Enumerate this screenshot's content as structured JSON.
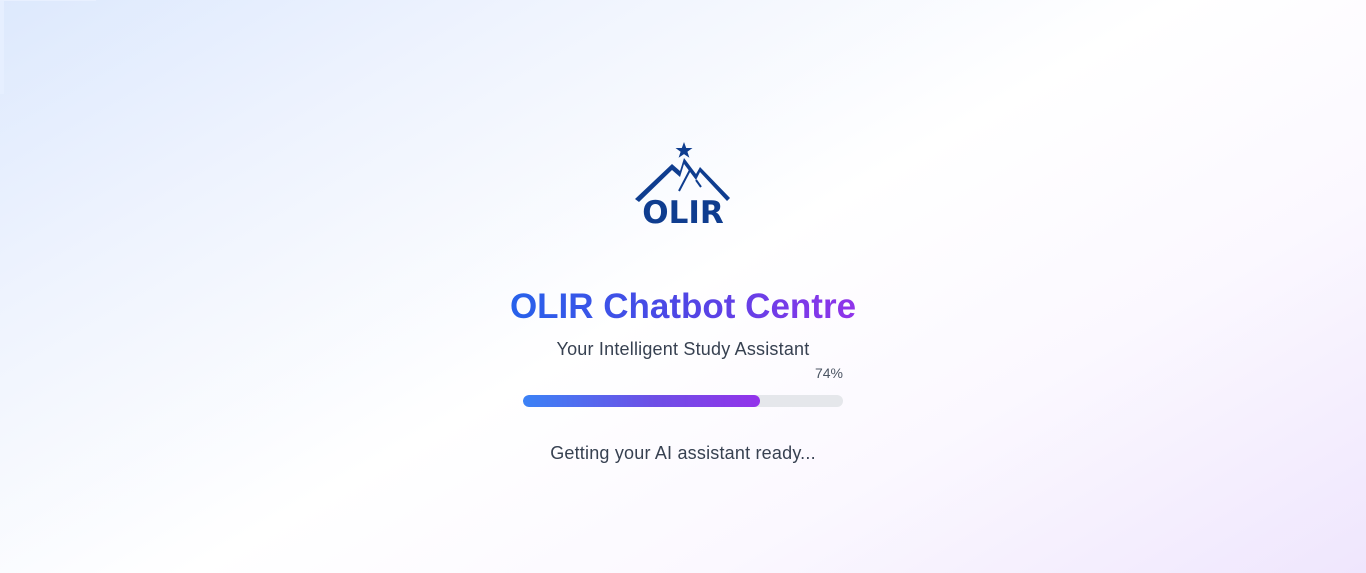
{
  "brand": {
    "logo_text": "OLIR",
    "logo_color": "#0f3d8f"
  },
  "title": "OLIR Chatbot Centre",
  "subtitle": "Your Intelligent Study Assistant",
  "progress": {
    "value": 0.74,
    "label": "74%"
  },
  "status": "Getting your AI assistant ready...",
  "colors": {
    "gradient_start": "#2563eb",
    "gradient_end": "#9333ea",
    "track": "#e5e7eb",
    "text": "#374151"
  }
}
